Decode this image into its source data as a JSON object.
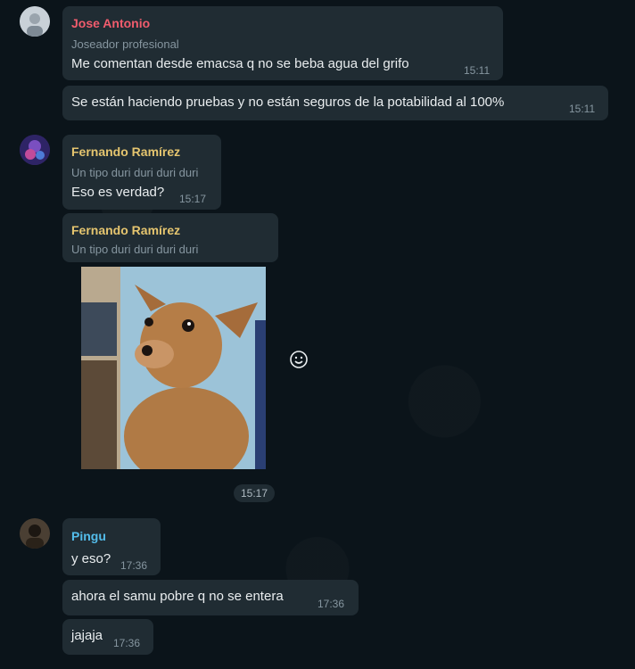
{
  "messages": [
    {
      "sender": "Jose Antonio",
      "subtitle": "Joseador profesional",
      "text": "Me comentan desde emacsa q no se beba agua del grifo",
      "time": "15:11"
    },
    {
      "text": "Se están haciendo pruebas y no están seguros de la potabilidad al 100%",
      "time": "15:11"
    },
    {
      "sender": "Fernando Ramírez",
      "subtitle": "Un tipo duri duri duri duri",
      "text": "Eso es verdad?",
      "time": "15:17"
    },
    {
      "sender": "Fernando Ramírez",
      "subtitle": "Un tipo duri duri duri duri",
      "image": "dog-photo",
      "time": "15:17"
    },
    {
      "sender": "Pingu",
      "text": "y eso?",
      "time": "17:36"
    },
    {
      "text": "ahora el samu pobre q no se entera",
      "time": "17:36"
    },
    {
      "text": "jajaja",
      "time": "17:36"
    }
  ],
  "colors": {
    "jose": "#f15c6d",
    "fernando": "#e5c56f",
    "pingu": "#53bdeb",
    "bubble": "#202c33"
  },
  "icons": {
    "react": "emoji-smile-icon"
  }
}
